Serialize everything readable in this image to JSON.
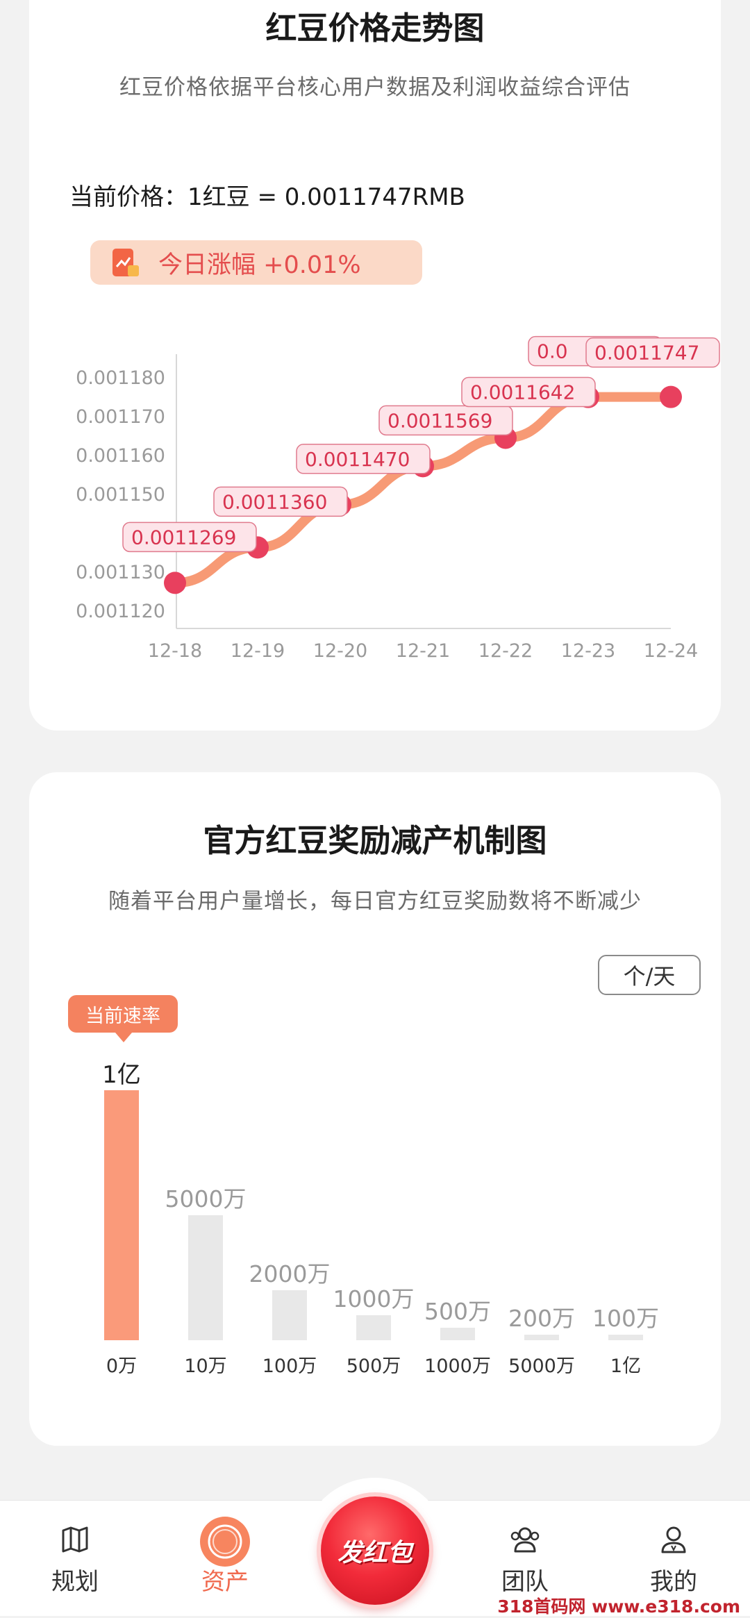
{
  "price_card": {
    "title": "红豆价格走势图",
    "subtitle": "红豆价格依据平台核心用户数据及利润收益综合评估",
    "current_price": "当前价格：1红豆  = 0.0011747RMB",
    "today_change": "今日涨幅 +0.01%",
    "colors": {
      "line": "#f79a75",
      "point": "#e8405e",
      "label_bg": "#fde4e9",
      "label_border": "#e07a8d",
      "label_text": "#d8334f"
    }
  },
  "chart_data": {
    "type": "line",
    "x": [
      "12-18",
      "12-19",
      "12-20",
      "12-21",
      "12-22",
      "12-23",
      "12-24"
    ],
    "values": [
      0.0011269,
      0.001136,
      0.001147,
      0.0011569,
      0.0011642,
      0.0011747,
      0.0011747
    ],
    "data_labels": [
      "0.0011269",
      "0.0011360",
      "0.0011470",
      "0.0011569",
      "0.0011642",
      "0.0",
      "0.0011747"
    ],
    "y_ticks": [
      "0.001180",
      "0.001170",
      "0.001160",
      "0.001150",
      "0.00",
      "0.001130",
      "0.001120"
    ],
    "y_tick_values": [
      0.00118,
      0.00117,
      0.00116,
      0.00115,
      0.00114,
      0.00113,
      0.00112
    ],
    "ylim": [
      0.00112,
      0.00118
    ]
  },
  "reward_card": {
    "title": "官方红豆奖励减产机制图",
    "subtitle": "随着平台用户量增长，每日官方红豆奖励数将不断减少",
    "unit": "个/天",
    "current_tag": "当前速率",
    "bars": [
      {
        "x": "0万",
        "label": "1亿",
        "value": 100000000,
        "current": true
      },
      {
        "x": "10万",
        "label": "5000万",
        "value": 50000000,
        "current": false
      },
      {
        "x": "100万",
        "label": "2000万",
        "value": 20000000,
        "current": false
      },
      {
        "x": "500万",
        "label": "1000万",
        "value": 10000000,
        "current": false
      },
      {
        "x": "1000万",
        "label": "500万",
        "value": 5000000,
        "current": false
      },
      {
        "x": "5000万",
        "label": "200万",
        "value": 2000000,
        "current": false
      },
      {
        "x": "1亿",
        "label": "100万",
        "value": 1000000,
        "current": false
      }
    ],
    "colors": {
      "current": "#fa9a7a",
      "other": "#e8e8e8"
    }
  },
  "nav": {
    "items": [
      {
        "label": "规划",
        "icon": "map-icon",
        "active": false
      },
      {
        "label": "资产",
        "icon": "asset-icon",
        "active": true
      },
      {
        "label": "团队",
        "icon": "team-icon",
        "active": false
      },
      {
        "label": "我的",
        "icon": "profile-icon",
        "active": false
      }
    ],
    "fab_label": "发红包",
    "accent": "#f06a4f"
  },
  "watermark": "318首码网 www.e318.com"
}
